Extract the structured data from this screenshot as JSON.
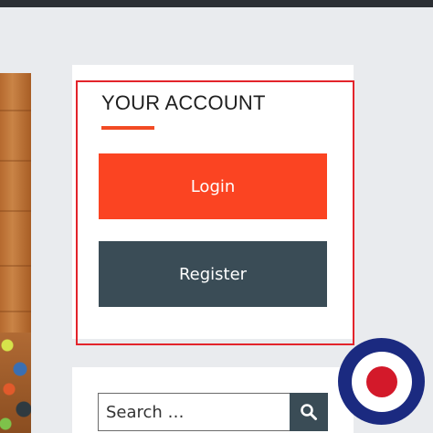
{
  "widget": {
    "title": "YOUR ACCOUNT",
    "login_label": "Login",
    "register_label": "Register"
  },
  "search": {
    "placeholder": "Search …",
    "button_icon": "search-icon"
  },
  "badge": {
    "icon": "roundel-icon"
  },
  "colors": {
    "accent": "#fb4422",
    "secondary": "#3a4c56",
    "highlight": "#e3242b",
    "roundel_blue": "#1b2a80",
    "roundel_red": "#d3192a"
  }
}
